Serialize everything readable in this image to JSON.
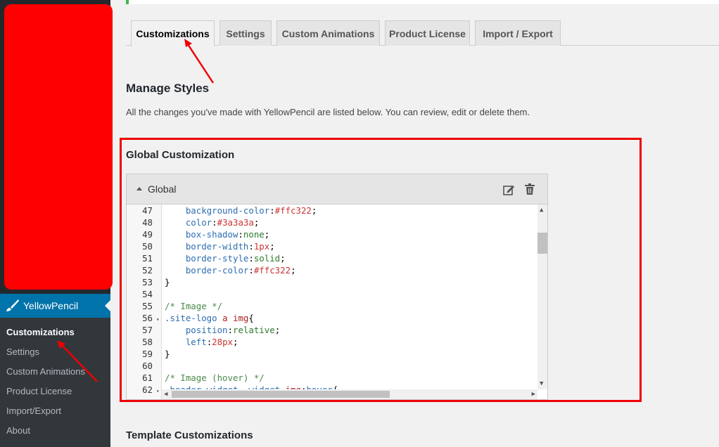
{
  "sidebar": {
    "plugin_label": "YellowPencil",
    "submenu": [
      {
        "label": "Customizations",
        "current": true
      },
      {
        "label": "Settings",
        "current": false
      },
      {
        "label": "Custom Animations",
        "current": false
      },
      {
        "label": "Product License",
        "current": false
      },
      {
        "label": "Import/Export",
        "current": false
      },
      {
        "label": "About",
        "current": false
      }
    ]
  },
  "tabs": [
    {
      "label": "Customizations",
      "active": true
    },
    {
      "label": "Settings",
      "active": false
    },
    {
      "label": "Custom Animations",
      "active": false
    },
    {
      "label": "Product License",
      "active": false
    },
    {
      "label": "Import / Export",
      "active": false
    }
  ],
  "main": {
    "heading": "Manage Styles",
    "description": "All the changes you've made with YellowPencil are listed below. You can review, edit or delete them.",
    "global_heading": "Global Customization",
    "panel_title": "Global",
    "template_heading": "Template Customizations"
  },
  "code_lines": [
    {
      "n": "47",
      "fold": false,
      "html": "    <span class='prop'>background-color</span>:<span class='num'>#ffc322</span>;"
    },
    {
      "n": "48",
      "fold": false,
      "html": "    <span class='prop'>color</span>:<span class='num'>#3a3a3a</span>;"
    },
    {
      "n": "49",
      "fold": false,
      "html": "    <span class='prop'>box-shadow</span>:<span class='val'>none</span>;"
    },
    {
      "n": "50",
      "fold": false,
      "html": "    <span class='prop'>border-width</span>:<span class='num'>1px</span>;"
    },
    {
      "n": "51",
      "fold": false,
      "html": "    <span class='prop'>border-style</span>:<span class='val'>solid</span>;"
    },
    {
      "n": "52",
      "fold": false,
      "html": "    <span class='prop'>border-color</span>:<span class='num'>#ffc322</span>;"
    },
    {
      "n": "53",
      "fold": false,
      "html": "}"
    },
    {
      "n": "54",
      "fold": false,
      "html": ""
    },
    {
      "n": "55",
      "fold": false,
      "html": "<span class='cmt'>/* Image */</span>"
    },
    {
      "n": "56",
      "fold": true,
      "html": "<span class='sel'>.site-logo</span> <span class='tag'>a</span> <span class='tag'>img</span>{"
    },
    {
      "n": "57",
      "fold": false,
      "html": "    <span class='prop'>position</span>:<span class='val'>relative</span>;"
    },
    {
      "n": "58",
      "fold": false,
      "html": "    <span class='prop'>left</span>:<span class='num'>28px</span>;"
    },
    {
      "n": "59",
      "fold": false,
      "html": "}"
    },
    {
      "n": "60",
      "fold": false,
      "html": ""
    },
    {
      "n": "61",
      "fold": false,
      "html": "<span class='cmt'>/* Image (hover) */</span>"
    },
    {
      "n": "62",
      "fold": true,
      "html": "<span class='sel'>.header-widget .widget</span> <span class='tag'>img</span>:<span class='sel'>hover</span>{"
    }
  ],
  "colors": {
    "sidebar_bg": "#23282d",
    "submenu_bg": "#32373c",
    "active_menu": "#0073aa",
    "highlight": "#e00000",
    "notice_border": "#46b450"
  }
}
